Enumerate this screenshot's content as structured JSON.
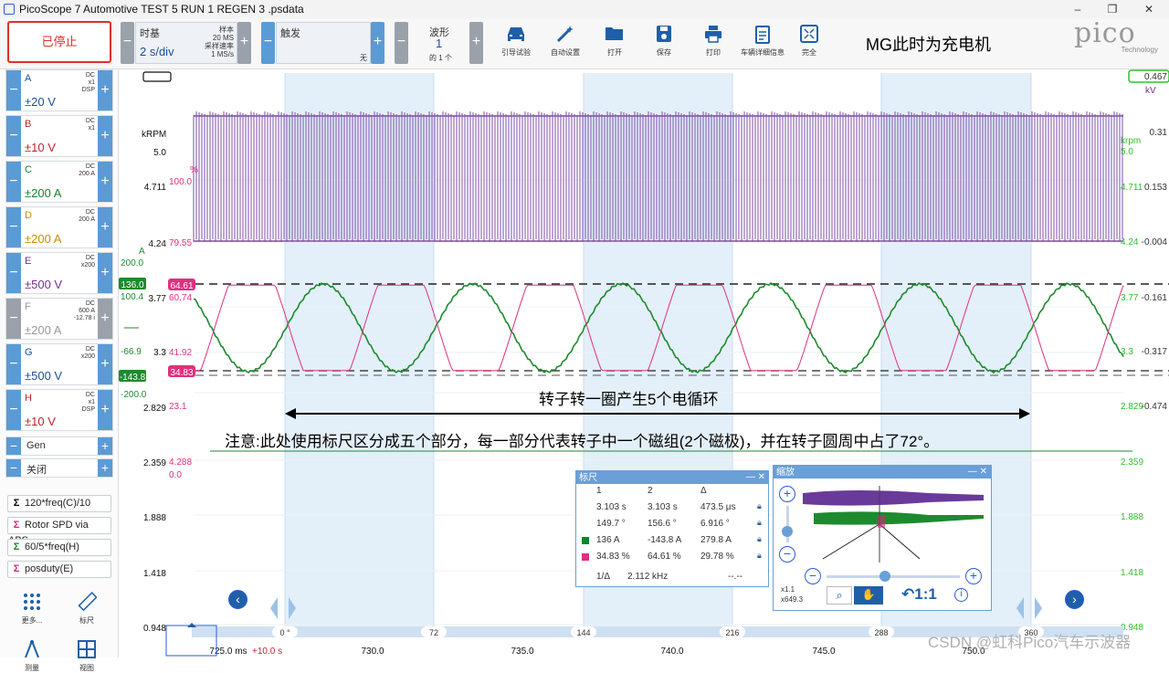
{
  "window": {
    "title": "PicoScope 7 Automotive TEST 5 RUN 1 REGEN 3 .psdata",
    "minimize": "–",
    "maximize": "❐",
    "close": "✕"
  },
  "toolbar": {
    "run_state": "已停止",
    "timebase_label": "时基",
    "timebase_value": "2 s/div",
    "sample_info": [
      "样本",
      "20 MS",
      "采样速率",
      "1 MS/s"
    ],
    "trigger_label": "触发",
    "trigger_mode": "无",
    "waveform_label": "波形",
    "waveform_value": "1",
    "waveform_of": "的 1 个",
    "tools": [
      {
        "label": "引导试验",
        "icon": "car-icon"
      },
      {
        "label": "自动设置",
        "icon": "wand-icon"
      },
      {
        "label": "打开",
        "icon": "folder-icon"
      },
      {
        "label": "保存",
        "icon": "save-icon"
      },
      {
        "label": "打印",
        "icon": "printer-icon"
      },
      {
        "label": "车辆详细信息",
        "icon": "clipboard-icon"
      },
      {
        "label": "完全",
        "icon": "fullscreen-icon"
      }
    ],
    "annotation": "MG此时为充电机",
    "logo_text": "pico",
    "logo_sub": "Technology"
  },
  "channels": [
    {
      "name": "A",
      "range": "±20 V",
      "info": [
        "DC",
        "x1",
        "DSP"
      ],
      "color": "#1a4f9c",
      "enabled": true
    },
    {
      "name": "B",
      "range": "±10 V",
      "info": [
        "DC",
        "x1"
      ],
      "color": "#c0242a",
      "enabled": true
    },
    {
      "name": "C",
      "range": "±200 A",
      "info": [
        "DC",
        "200 A"
      ],
      "color": "#12852c",
      "enabled": true
    },
    {
      "name": "D",
      "range": "±200 A",
      "info": [
        "DC",
        "200 A"
      ],
      "color": "#c98a0a",
      "enabled": true
    },
    {
      "name": "E",
      "range": "±500 V",
      "info": [
        "DC",
        "x200"
      ],
      "color": "#7a2b8f",
      "enabled": true
    },
    {
      "name": "F",
      "range": "±200 A",
      "info": [
        "DC",
        "600 A",
        "-12.78 i"
      ],
      "color": "#9a9a9a",
      "enabled": false
    },
    {
      "name": "G",
      "range": "±500 V",
      "info": [
        "DC",
        "x200"
      ],
      "color": "#1a4f9c",
      "enabled": true
    },
    {
      "name": "H",
      "range": "±10 V",
      "info": [
        "DC",
        "x1",
        "DSP"
      ],
      "color": "#c0242a",
      "enabled": true
    }
  ],
  "generator": {
    "label": "Gen",
    "state": "关闭"
  },
  "math_channels": [
    {
      "label": "120*freq(C)/10",
      "color": "#000000"
    },
    {
      "label": "Rotor SPD via ABS",
      "color": "#d4247a"
    },
    {
      "label": "60/5*freq(H)",
      "color": "#12852c"
    },
    {
      "label": "posduty(E)",
      "color": "#d4247a"
    }
  ],
  "side_tools": [
    {
      "label": "更多...",
      "icon": "grid-dots-icon"
    },
    {
      "label": "标尺",
      "icon": "ruler-icon"
    },
    {
      "label": "测量",
      "icon": "compass-icon"
    },
    {
      "label": "视图",
      "icon": "view-grid-icon"
    }
  ],
  "axes": {
    "left_black": [
      "kRPM",
      "5.0",
      "4.711",
      "4.24",
      "3.77",
      "3.3",
      "2.829",
      "2.359",
      "1.888",
      "1.418",
      "0.948"
    ],
    "left_pink": [
      "%",
      "100.0",
      "79.55",
      "64.61",
      "60.74",
      "41.92",
      "34.83",
      "23.1",
      "4.288",
      "0.0"
    ],
    "left_green": [
      "A",
      "200.0",
      "136.0",
      "100.4",
      "-66.9",
      "-143.8",
      "-200.0"
    ],
    "right_green": [
      "krpm",
      "5.0",
      "4.711",
      "4.24",
      "3.77",
      "3.3",
      "2.829",
      "2.359",
      "1.888",
      "1.418",
      "0.948"
    ],
    "right_black": [
      "0.31",
      "0.153",
      "-0.004",
      "-0.161",
      "-0.317",
      "-0.474"
    ],
    "right_top_marker": "0.467",
    "right_unit": "kV",
    "x_ticks": [
      "725.0 ms",
      "730.0",
      "735.0",
      "740.0",
      "745.0",
      "750.0"
    ],
    "x_offset": "+10.0 s",
    "phase_ticks": [
      "0 °",
      "72",
      "144",
      "216",
      "288",
      "360"
    ]
  },
  "annotations": {
    "cycle_text": "转子转一圈产生5个电循环",
    "note_text": "注意:此处使用标尺区分成五个部分，每一部分代表转子中一个磁组(2个磁极)，并在转子圆周中占了72°。"
  },
  "ruler_panel": {
    "title": "标尺",
    "headers": [
      "1",
      "2",
      "Δ"
    ],
    "rows": [
      {
        "c1": "3.103 s",
        "c2": "3.103 s",
        "d": "473.5 μs",
        "swatch": ""
      },
      {
        "c1": "149.7 °",
        "c2": "156.6 °",
        "d": "6.916 °",
        "swatch": ""
      },
      {
        "c1": "136 A",
        "c2": "-143.8 A",
        "d": "279.8 A",
        "swatch": "#12852c"
      },
      {
        "c1": "34.83 %",
        "c2": "64.61 %",
        "d": "29.78 %",
        "swatch": "#e0307f"
      }
    ],
    "freq_label": "1/Δ",
    "freq_value": "2.112 kHz",
    "freq_extra": "--.--"
  },
  "zoom_panel": {
    "title": "缩放",
    "zoom_x": "x1.1",
    "zoom_y": "x649.3",
    "reset": "1:1"
  },
  "colors": {
    "purple": "#7d4fa8",
    "green": "#1e8a2e",
    "pink": "#e0307f",
    "accent": "#5b9bd5",
    "shade": "#dcebf8"
  },
  "watermark": "CSDN @虹科Pico汽车示波器"
}
